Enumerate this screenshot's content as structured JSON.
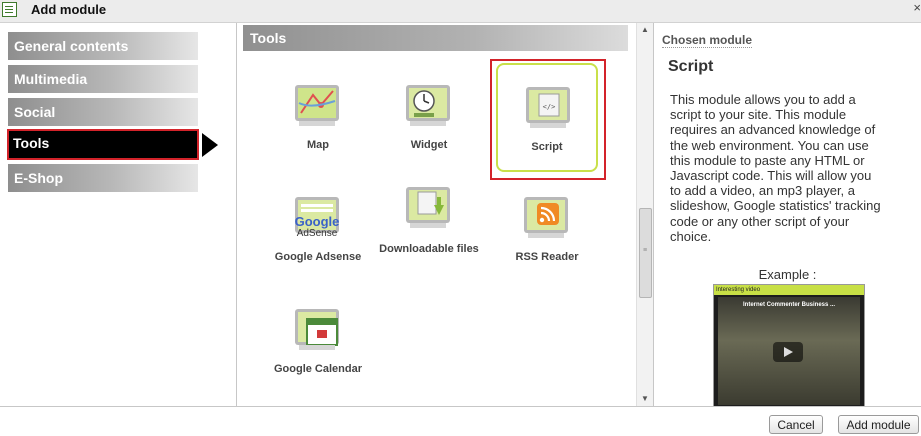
{
  "window": {
    "title": "Add module",
    "close_glyph": "×"
  },
  "sidebar": {
    "items": [
      {
        "label": "General contents",
        "active": false
      },
      {
        "label": "Multimedia",
        "active": false
      },
      {
        "label": "Social",
        "active": false
      },
      {
        "label": "Tools",
        "active": true
      },
      {
        "label": "E-Shop",
        "active": false
      }
    ]
  },
  "tools": {
    "header": "Tools",
    "modules": [
      {
        "label": "Map",
        "icon": "map-icon",
        "selected": false
      },
      {
        "label": "Widget",
        "icon": "clock-widget-icon",
        "selected": false
      },
      {
        "label": "Script",
        "icon": "script-icon",
        "selected": true
      },
      {
        "label": "Google Adsense",
        "icon": "google-adsense-icon",
        "selected": false
      },
      {
        "label": "Downloadable files",
        "icon": "download-icon",
        "selected": false
      },
      {
        "label": "RSS Reader",
        "icon": "rss-icon",
        "selected": false
      },
      {
        "label": "Google Calendar",
        "icon": "calendar-icon",
        "selected": false
      }
    ],
    "adsense_text_1": "Google",
    "adsense_text_2": "AdSense"
  },
  "details": {
    "chosen_label": "Chosen module",
    "module_name": "Script",
    "description": "This module allows you to add a script to your site. This module requires an advanced knowledge of the web environment. You can use this module to paste any HTML or Javascript code. This will allow you to add a video, an mp3 player, a slideshow, Google statistics' tracking code or any other script of your choice.",
    "example_label": "Example :",
    "video_header": "Interesting video",
    "video_title": "Internet Commenter Business ..."
  },
  "buttons": {
    "cancel": "Cancel",
    "add": "Add module"
  },
  "colors": {
    "accent_red": "#d3232a",
    "accent_green": "#c9e04a"
  }
}
